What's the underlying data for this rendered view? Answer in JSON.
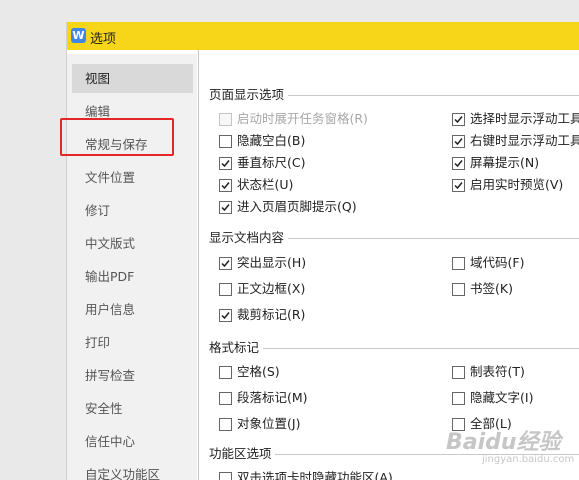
{
  "window": {
    "title": "选项"
  },
  "sidebar": {
    "items": [
      {
        "label": "视图",
        "active": true
      },
      {
        "label": "编辑"
      },
      {
        "label": "常规与保存"
      },
      {
        "label": "文件位置"
      },
      {
        "label": "修订"
      },
      {
        "label": "中文版式"
      },
      {
        "label": "输出PDF"
      },
      {
        "label": "用户信息"
      },
      {
        "label": "打印"
      },
      {
        "label": "拼写检查"
      },
      {
        "label": "安全性"
      },
      {
        "label": "信任中心"
      },
      {
        "label": "自定义功能区"
      }
    ]
  },
  "sections": {
    "page_display": {
      "title": "页面显示选项",
      "left": [
        {
          "label": "启动时展开任务窗格(R)",
          "checked": false,
          "disabled": true
        },
        {
          "label": "隐藏空白(B)",
          "checked": false
        },
        {
          "label": "垂直标尺(C)",
          "checked": true
        },
        {
          "label": "状态栏(U)",
          "checked": true
        },
        {
          "label": "进入页眉页脚提示(Q)",
          "checked": true
        }
      ],
      "right": [
        {
          "label": "选择时显示浮动工具栏",
          "checked": true
        },
        {
          "label": "右键时显示浮动工具栏",
          "checked": true
        },
        {
          "label": "屏幕提示(N)",
          "checked": true
        },
        {
          "label": "启用实时预览(V)",
          "checked": true
        }
      ]
    },
    "doc_content": {
      "title": "显示文档内容",
      "left": [
        {
          "label": "突出显示(H)",
          "checked": true
        },
        {
          "label": "正文边框(X)",
          "checked": false
        },
        {
          "label": "裁剪标记(R)",
          "checked": true
        }
      ],
      "right": [
        {
          "label": "域代码(F)",
          "checked": false
        },
        {
          "label": "书签(K)",
          "checked": false
        }
      ]
    },
    "format_marks": {
      "title": "格式标记",
      "left": [
        {
          "label": "空格(S)",
          "checked": false
        },
        {
          "label": "段落标记(M)",
          "checked": false
        },
        {
          "label": "对象位置(J)",
          "checked": false
        }
      ],
      "right": [
        {
          "label": "制表符(T)",
          "checked": false
        },
        {
          "label": "隐藏文字(I)",
          "checked": false
        },
        {
          "label": "全部(L)",
          "checked": false
        }
      ]
    },
    "ribbon": {
      "title": "功能区选项",
      "left": [
        {
          "label": "双击选项卡时隐藏功能区(A)",
          "checked": false
        }
      ]
    }
  },
  "watermark": {
    "main": "Baidu经验",
    "sub": "jingyan.baidu.com"
  }
}
